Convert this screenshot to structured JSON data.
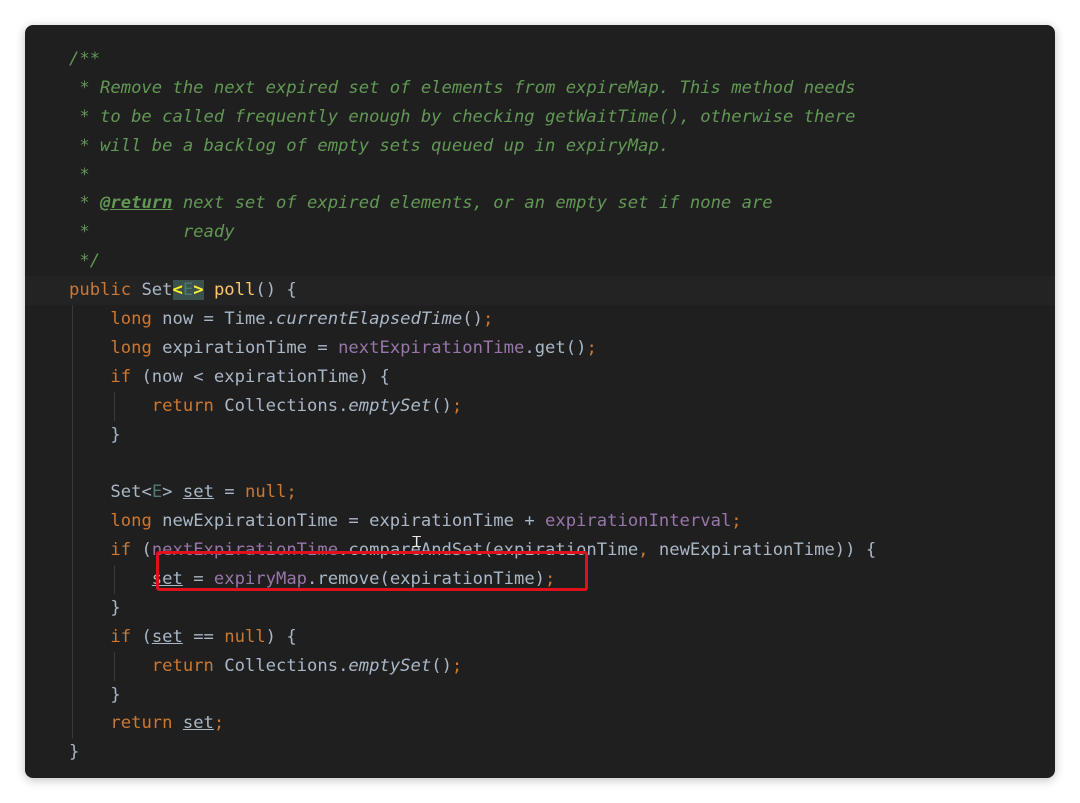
{
  "doc": {
    "l1": "/**",
    "l2": " * Remove the next expired set of elements from expireMap. This method needs",
    "l3": " * to be called frequently enough by checking getWaitTime(), otherwise there",
    "l4": " * will be a backlog of empty sets queued up in expiryMap.",
    "l5": " *",
    "l6_star": " * ",
    "l6_tag": "@return",
    "l6_text": " next set of expired elements, or an empty set if none are",
    "l7": " *         ready",
    "l8": " */"
  },
  "sig": {
    "public": "public",
    "set_type": "Set",
    "lt": "<",
    "e": "E",
    "gt": ">",
    "name": "poll",
    "tail": "() {"
  },
  "b1": {
    "long": "long",
    "a": " now = Time.",
    "call": "currentElapsedTime",
    "b": "()",
    "semi": ";"
  },
  "b2": {
    "long": "long",
    "a": " expirationTime = ",
    "field": "nextExpirationTime",
    "b": ".get()",
    "semi": ";"
  },
  "b3": {
    "if": "if",
    "a": " (now < expirationTime) {"
  },
  "b4": {
    "ret": "return",
    "a": " Collections.",
    "call": "emptySet",
    "b": "()",
    "semi": ";"
  },
  "b5": {
    "a": "}"
  },
  "b7": {
    "set_type": "Set<",
    "e": "E",
    "gt": "> ",
    "var": "set",
    "eq": " = ",
    "null": "null",
    "semi": ";"
  },
  "b8": {
    "long": "long",
    "a": " newExpirationTime = expirationTime + ",
    "field": "expirationInterval",
    "semi": ";"
  },
  "b9": {
    "if": "if",
    "paren": " (",
    "field": "nextExpirationTime",
    "a": ".compareAndSet(expirationTime",
    "comma": ",",
    "b": " newExpirationTime)) {"
  },
  "b10": {
    "var": "set",
    "eq": " = ",
    "field": "expiryMap",
    "a": ".remove(expirationTime)",
    "semi": ";"
  },
  "b11": {
    "a": "}"
  },
  "b12": {
    "if": "if",
    "paren": " (",
    "var": "set",
    "eq": " == ",
    "null": "null",
    "a": ") {"
  },
  "b13": {
    "ret": "return",
    "a": " Collections.",
    "call": "emptySet",
    "b": "()",
    "semi": ";"
  },
  "b14": {
    "a": "}"
  },
  "b15": {
    "ret": "return",
    "sp": " ",
    "var": "set",
    "semi": ";"
  },
  "b16": {
    "a": "}"
  },
  "cursor": {
    "glyph": "Ꮖ"
  },
  "colors": {
    "background": "#1f1f1f",
    "keyword": "#cc7832",
    "method_decl": "#ffc66d",
    "field": "#9876aa",
    "comment": "#629755",
    "plain": "#a9b7c6",
    "highlight_box": "#e0101c"
  }
}
